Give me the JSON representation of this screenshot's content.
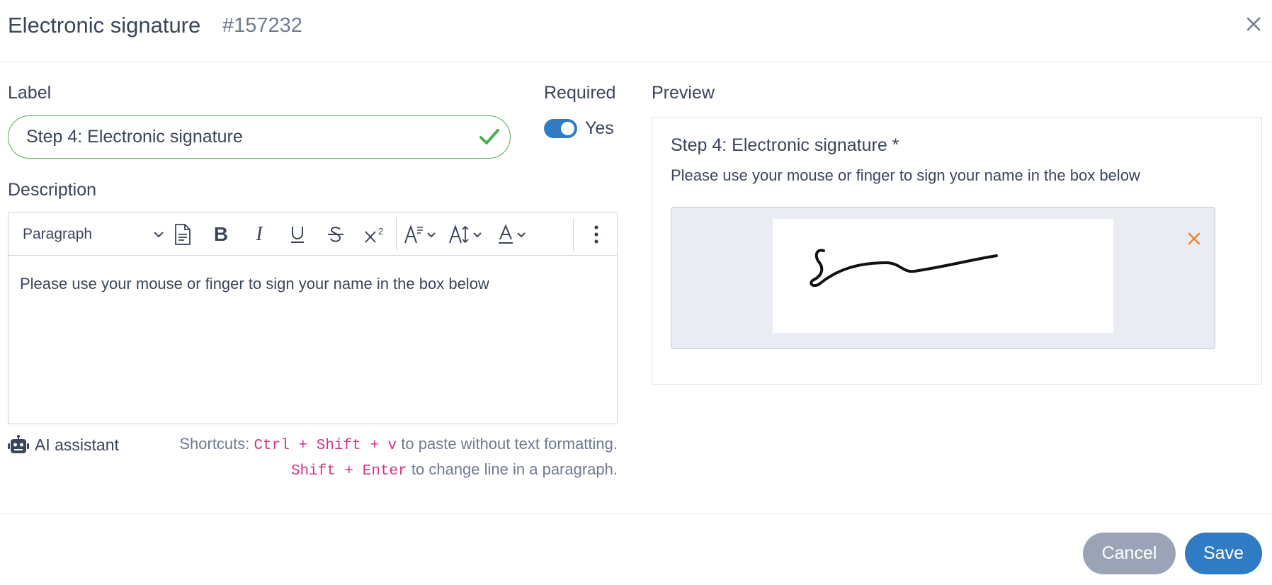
{
  "header": {
    "title": "Electronic signature",
    "id": "#157232"
  },
  "form": {
    "label_heading": "Label",
    "label_value": "Step 4: Electronic signature",
    "required_heading": "Required",
    "required_toggle_label": "Yes",
    "required_on": true,
    "description_heading": "Description"
  },
  "editor": {
    "paragraph_select": "Paragraph",
    "body_text": "Please use your mouse or finger to sign your name in the box below",
    "toolbar_icons": [
      "source-icon",
      "bold-icon",
      "italic-icon",
      "underline-icon",
      "strikethrough-icon",
      "superscript-icon",
      "line-spacing-icon",
      "font-size-icon",
      "font-color-icon",
      "more-options-icon"
    ]
  },
  "ai_assistant": {
    "label": "AI assistant"
  },
  "shortcuts": {
    "prefix": "Shortcuts:",
    "combo1": "Ctrl + Shift + v",
    "text1": "to paste without text formatting.",
    "combo2": "Shift + Enter",
    "text2": "to change line in a paragraph."
  },
  "preview": {
    "heading": "Preview",
    "title": "Step 4: Electronic signature *",
    "description": "Please use your mouse or finger to sign your name in the box below"
  },
  "footer": {
    "cancel_label": "Cancel",
    "save_label": "Save"
  },
  "colors": {
    "accent": "#2f7bc4",
    "success": "#4caf50",
    "danger": "#e8852f",
    "code": "#d63384"
  }
}
